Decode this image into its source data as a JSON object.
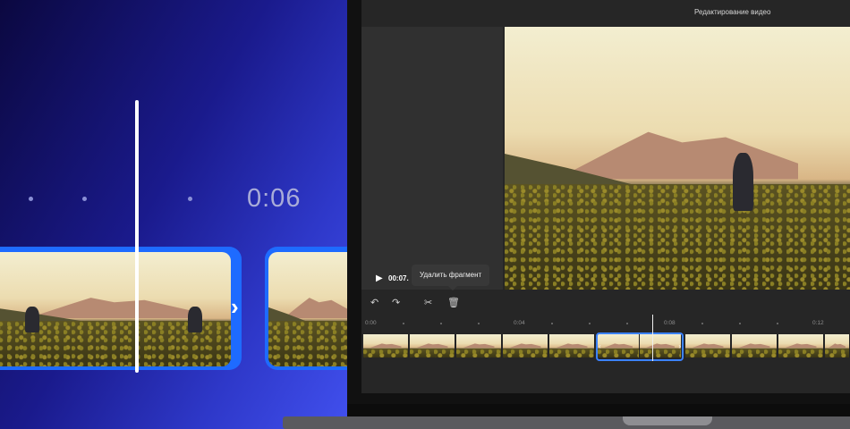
{
  "promo": {
    "time_label": "0:06",
    "next_icon": "chevron-right-icon"
  },
  "editor": {
    "title": "Редактирование видео",
    "player": {
      "play_icon": "play-icon",
      "current_time": "00:07.",
      "tooltip": "Удалить фрагмент"
    },
    "toolbar": {
      "undo_icon": "undo-icon",
      "redo_icon": "redo-icon",
      "split_icon": "scissors-icon",
      "delete_icon": "trash-icon"
    },
    "ruler": [
      "0:00",
      "0:04",
      "0:08",
      "0:12"
    ],
    "accent": "#3b82ff"
  }
}
